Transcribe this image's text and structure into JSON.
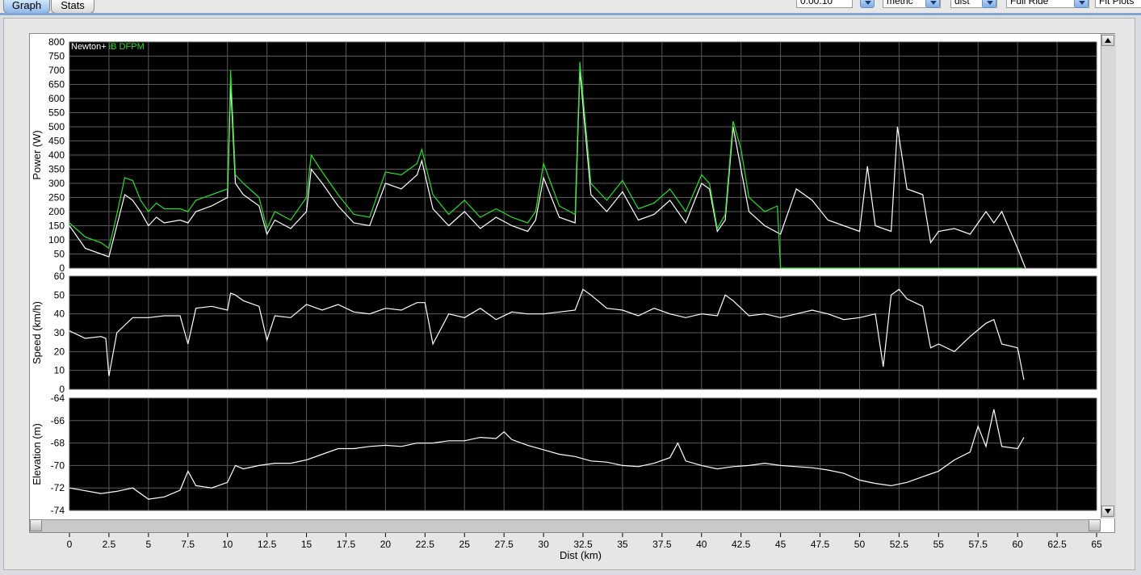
{
  "tabs": [
    {
      "label": "Graph"
    },
    {
      "label": "Stats"
    }
  ],
  "controls": {
    "smoothing_value": "0:00:10",
    "units_value": "metric",
    "xaxis_value": "dist",
    "range_value": "Full Ride",
    "fit_label": "Fit Plots"
  },
  "colors": {
    "plot_bg": "#000000",
    "grid": "#5a5a5a",
    "white_series": "#ffffff",
    "green_series": "#26e026",
    "accent": "#7ea6d4"
  },
  "icons": [
    "dropdown-arrow-icon",
    "scroll-up-icon",
    "scroll-down-icon",
    "scroll-left-icon",
    "scroll-right-icon"
  ],
  "chart_data": [
    {
      "type": "line",
      "ylabel": "Power (W)",
      "ylim": [
        0,
        800
      ],
      "yticks": [
        "0",
        "50",
        "100",
        "150",
        "200",
        "250",
        "300",
        "350",
        "400",
        "450",
        "500",
        "550",
        "600",
        "650",
        "700",
        "750",
        "800"
      ],
      "xlim": [
        0,
        65
      ],
      "legend_position": "top-left",
      "grid": true,
      "series": [
        {
          "name": "Newton+",
          "x": [
            0,
            1,
            2,
            2.5,
            3,
            3.5,
            4,
            4.5,
            5,
            5.5,
            6,
            7,
            7.5,
            8,
            9,
            10,
            10.2,
            10.5,
            11,
            12,
            12.5,
            13,
            14,
            15,
            15.3,
            16,
            17,
            18,
            19,
            20,
            21,
            22,
            22.3,
            23,
            24,
            25,
            26,
            27,
            28,
            29,
            29.5,
            30,
            31,
            32,
            32.3,
            33,
            34,
            35,
            36,
            37,
            38,
            39,
            40,
            40.5,
            41,
            41.5,
            42,
            42.5,
            43,
            44,
            45,
            46,
            47,
            48,
            49,
            50,
            50.5,
            51,
            52,
            52.4,
            53,
            54,
            54.5,
            55,
            56,
            57,
            58,
            58.5,
            59,
            60,
            60.5
          ],
          "y": [
            150,
            70,
            50,
            40,
            150,
            260,
            240,
            200,
            150,
            180,
            160,
            170,
            160,
            200,
            220,
            250,
            650,
            300,
            260,
            220,
            120,
            170,
            140,
            200,
            350,
            300,
            220,
            160,
            150,
            300,
            280,
            330,
            380,
            210,
            150,
            200,
            140,
            180,
            150,
            130,
            170,
            320,
            180,
            160,
            700,
            260,
            200,
            270,
            170,
            190,
            240,
            160,
            300,
            280,
            130,
            170,
            500,
            350,
            200,
            150,
            120,
            280,
            240,
            170,
            150,
            130,
            360,
            150,
            130,
            500,
            280,
            260,
            90,
            130,
            140,
            120,
            200,
            160,
            200,
            70,
            0
          ]
        },
        {
          "name": "iB DFPM",
          "x": [
            0,
            1,
            2,
            2.5,
            3,
            3.5,
            4,
            4.5,
            5,
            5.5,
            6,
            7,
            7.5,
            8,
            9,
            10,
            10.2,
            10.5,
            11,
            12,
            12.5,
            13,
            14,
            15,
            15.3,
            16,
            17,
            18,
            19,
            20,
            21,
            22,
            22.3,
            23,
            24,
            25,
            26,
            27,
            28,
            29,
            29.5,
            30,
            31,
            32,
            32.3,
            33,
            34,
            35,
            36,
            37,
            38,
            39,
            40,
            40.5,
            41,
            41.5,
            42,
            42.5,
            43,
            44,
            44.8,
            45,
            50,
            55,
            60,
            60.3
          ],
          "y": [
            160,
            110,
            90,
            70,
            190,
            320,
            310,
            240,
            200,
            230,
            210,
            210,
            200,
            240,
            260,
            280,
            700,
            330,
            300,
            250,
            140,
            200,
            170,
            250,
            400,
            340,
            260,
            190,
            180,
            340,
            330,
            370,
            420,
            260,
            190,
            240,
            180,
            210,
            180,
            160,
            200,
            370,
            220,
            190,
            730,
            300,
            240,
            310,
            210,
            230,
            280,
            200,
            330,
            300,
            140,
            190,
            520,
            420,
            250,
            200,
            220,
            0,
            0,
            0,
            0,
            0
          ]
        }
      ]
    },
    {
      "type": "line",
      "ylabel": "Speed (km/h)",
      "ylim": [
        0,
        60
      ],
      "yticks": [
        "0",
        "10",
        "20",
        "30",
        "40",
        "50",
        "60"
      ],
      "xlim": [
        0,
        65
      ],
      "grid": true,
      "series": [
        {
          "name": "",
          "x": [
            0,
            1,
            2,
            2.3,
            2.5,
            3,
            4,
            5,
            6,
            7,
            7.5,
            8,
            9,
            10,
            10.2,
            10.5,
            11,
            12,
            12.5,
            13,
            14,
            15,
            16,
            17,
            18,
            19,
            20,
            21,
            22,
            22.5,
            23,
            24,
            25,
            26,
            27,
            28,
            29,
            30,
            31,
            32,
            32.5,
            33,
            34,
            35,
            36,
            37,
            38,
            39,
            40,
            41,
            41.5,
            42,
            43,
            44,
            45,
            46,
            47,
            48,
            49,
            50,
            51,
            51.5,
            52,
            52.5,
            53,
            54,
            54.5,
            55,
            56,
            57,
            58,
            58.5,
            59,
            60,
            60.4
          ],
          "y": [
            31,
            27,
            28,
            27,
            7,
            30,
            38,
            38,
            39,
            39,
            24,
            43,
            44,
            42,
            51,
            50,
            47,
            44,
            26,
            39,
            38,
            45,
            42,
            45,
            41,
            40,
            43,
            42,
            46,
            46,
            24,
            40,
            38,
            43,
            37,
            41,
            40,
            40,
            41,
            42,
            53,
            50,
            43,
            42,
            39,
            43,
            40,
            38,
            40,
            39,
            50,
            47,
            39,
            40,
            38,
            40,
            42,
            40,
            37,
            38,
            40,
            12,
            50,
            53,
            48,
            44,
            22,
            24,
            20,
            28,
            35,
            37,
            24,
            22,
            5
          ]
        }
      ]
    },
    {
      "type": "line",
      "ylabel": "Elevation (m)",
      "ylim": [
        -74,
        -64
      ],
      "yticks": [
        "-74",
        "-72",
        "-70",
        "-68",
        "-66",
        "-64"
      ],
      "xlim": [
        0,
        65
      ],
      "grid": true,
      "series": [
        {
          "name": "",
          "x": [
            0,
            2,
            3,
            4,
            5,
            6,
            7,
            7.5,
            8,
            9,
            10,
            10.5,
            11,
            12,
            13,
            14,
            15,
            16,
            17,
            18,
            19,
            20,
            21,
            22,
            23,
            24,
            25,
            26,
            27,
            27.5,
            28,
            29,
            30,
            31,
            32,
            33,
            34,
            35,
            36,
            37,
            38,
            38.5,
            39,
            40,
            41,
            42,
            43,
            44,
            45,
            46,
            47,
            48,
            49,
            50,
            51,
            52,
            53,
            54,
            55,
            56,
            57,
            57.5,
            58,
            58.5,
            59,
            60,
            60.4
          ],
          "y": [
            -72,
            -72.5,
            -72.3,
            -72,
            -73,
            -72.8,
            -72.2,
            -70.5,
            -71.8,
            -72,
            -71.5,
            -70,
            -70.3,
            -70,
            -69.8,
            -69.8,
            -69.5,
            -69,
            -68.5,
            -68.5,
            -68.3,
            -68.2,
            -68.3,
            -68,
            -68,
            -67.8,
            -67.8,
            -67.5,
            -67.6,
            -67,
            -67.7,
            -68.2,
            -68.6,
            -69,
            -69.2,
            -69.6,
            -69.7,
            -70,
            -70.1,
            -69.8,
            -69.3,
            -68,
            -69.6,
            -70,
            -70.3,
            -70.1,
            -70,
            -69.8,
            -70,
            -70.1,
            -70.2,
            -70.4,
            -70.7,
            -71.3,
            -71.6,
            -71.8,
            -71.5,
            -71,
            -70.5,
            -69.5,
            -68.8,
            -66.5,
            -68.3,
            -65,
            -68.3,
            -68.5,
            -67.5
          ]
        }
      ]
    }
  ],
  "xaxis": {
    "xlabel": "Dist (km)",
    "ticks": [
      "0",
      "2.5",
      "5",
      "7.5",
      "10",
      "12.5",
      "15",
      "17.5",
      "20",
      "22.5",
      "25",
      "27.5",
      "30",
      "32.5",
      "35",
      "37.5",
      "40",
      "42.5",
      "45",
      "47.5",
      "50",
      "52.5",
      "55",
      "57.5",
      "60",
      "62.5",
      "65"
    ]
  }
}
